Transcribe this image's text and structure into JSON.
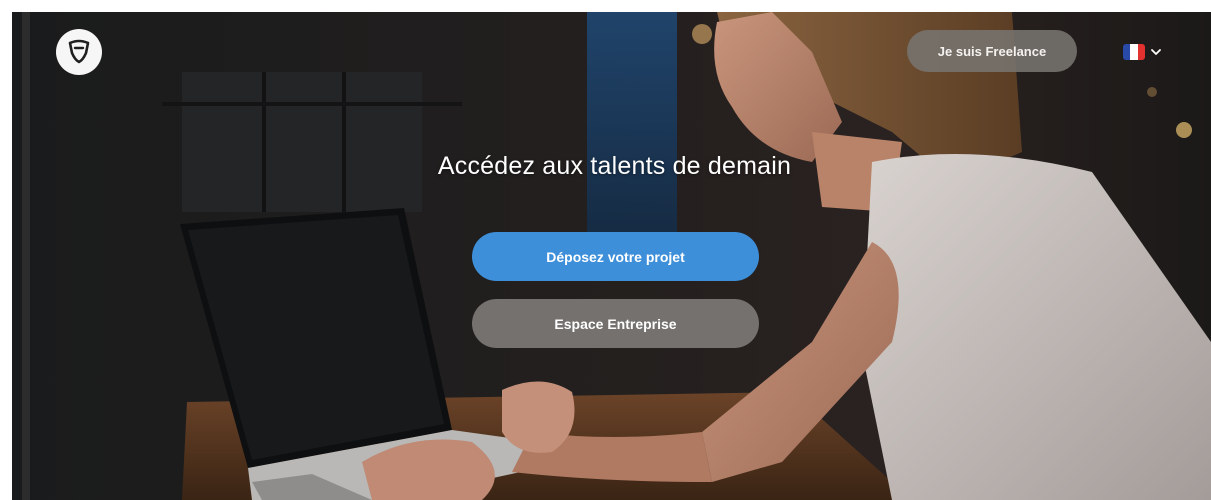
{
  "header": {
    "logo_icon": "shield-logo-icon",
    "freelance_label": "Je suis Freelance",
    "language": {
      "flag": "france-flag-icon",
      "chevron": "chevron-down-icon",
      "flag_colors": [
        "#2a4aa8",
        "#ffffff",
        "#e2312f"
      ]
    }
  },
  "hero": {
    "headline": "Accédez aux talents de demain",
    "primary_cta": "Déposez votre projet",
    "secondary_cta": "Espace Entreprise"
  },
  "colors": {
    "primary": "#3e8fd9",
    "secondary": "#7d7a78",
    "freelance_button": "#787470"
  }
}
